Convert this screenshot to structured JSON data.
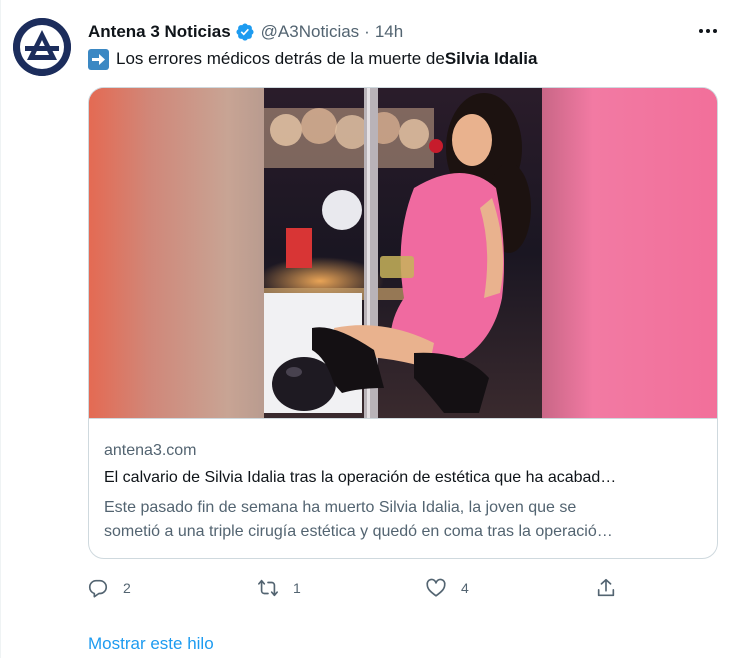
{
  "author": {
    "name": "Antena 3 Noticias",
    "handle": "@A3Noticias",
    "separator": "·",
    "time": "14h"
  },
  "tweet": {
    "text_prefix": "Los errores médicos detrás de la muerte de ",
    "text_bold": "Silvia Idalia",
    "emoji": "arrow-right-emoji"
  },
  "card": {
    "domain": "antena3.com",
    "title": "El calvario de Silvia Idalia tras la operación de estética que ha acabad…",
    "description_line1": "Este pasado fin de semana ha muerto Silvia Idalia, la joven que se",
    "description_line2": "sometió a una triple cirugía estética y quedó en coma tras la operació…"
  },
  "actions": {
    "reply_count": "2",
    "retweet_count": "1",
    "like_count": "4"
  },
  "footer": {
    "show_thread": "Mostrar este hilo"
  },
  "colors": {
    "accent": "#1d9bf0",
    "secondary_text": "#536471",
    "border": "#cfd9de",
    "avatar_bg": "#1c2d5c"
  }
}
